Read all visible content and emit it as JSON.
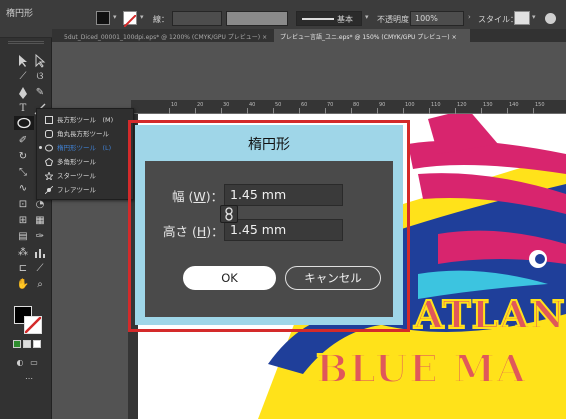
{
  "control_bar": {
    "app_label": "楕円形",
    "stroke_label": "線：",
    "stroke_value": "",
    "brush_label": "基本",
    "opacity_label": "不透明度：",
    "opacity_value": "100%",
    "style_label": "スタイル："
  },
  "tabs": [
    {
      "label": "5dut_Diced_00001_100dpi.eps* @ 1200% (CMYK/GPU プレビュー)",
      "close": "×"
    },
    {
      "label": "プレビュー言語_ユニ.eps* @ 150% (CMYK/GPU プレビュー)",
      "close": "×"
    }
  ],
  "ruler": {
    "ticks": [
      "10",
      "20",
      "30",
      "40",
      "50",
      "60",
      "70",
      "80",
      "90",
      "100",
      "110",
      "120",
      "130",
      "140",
      "150"
    ]
  },
  "flyout": {
    "items": [
      {
        "label": "長方形ツール　(M)",
        "icon": "rectangle-icon"
      },
      {
        "label": "角丸長方形ツール",
        "icon": "rounded-rectangle-icon"
      },
      {
        "label": "楕円形ツール　(L)",
        "icon": "ellipse-icon"
      },
      {
        "label": "多角形ツール",
        "icon": "polygon-icon"
      },
      {
        "label": "スターツール",
        "icon": "star-icon"
      },
      {
        "label": "フレアツール",
        "icon": "flare-icon"
      }
    ]
  },
  "dialog": {
    "title": "楕円形",
    "width_label": "幅 (",
    "width_key": "W",
    "width_label_end": ")：",
    "width_value": "1.45 mm",
    "height_label": "高さ (",
    "height_key": "H",
    "height_label_end": ")：",
    "height_value": "1.45 mm",
    "ok_label": "OK",
    "cancel_label": "キャンセル"
  },
  "artwork": {
    "line1": "ATLAN",
    "line2": "BLUE MA"
  },
  "colors": {
    "dialog_frame": "#9fd6e8",
    "highlight": "#d42a2a",
    "fish_blue": "#1f3f9a",
    "fish_magenta": "#d8256e",
    "fish_yellow": "#ffe21a",
    "fish_cyan": "#3cc4e0"
  }
}
